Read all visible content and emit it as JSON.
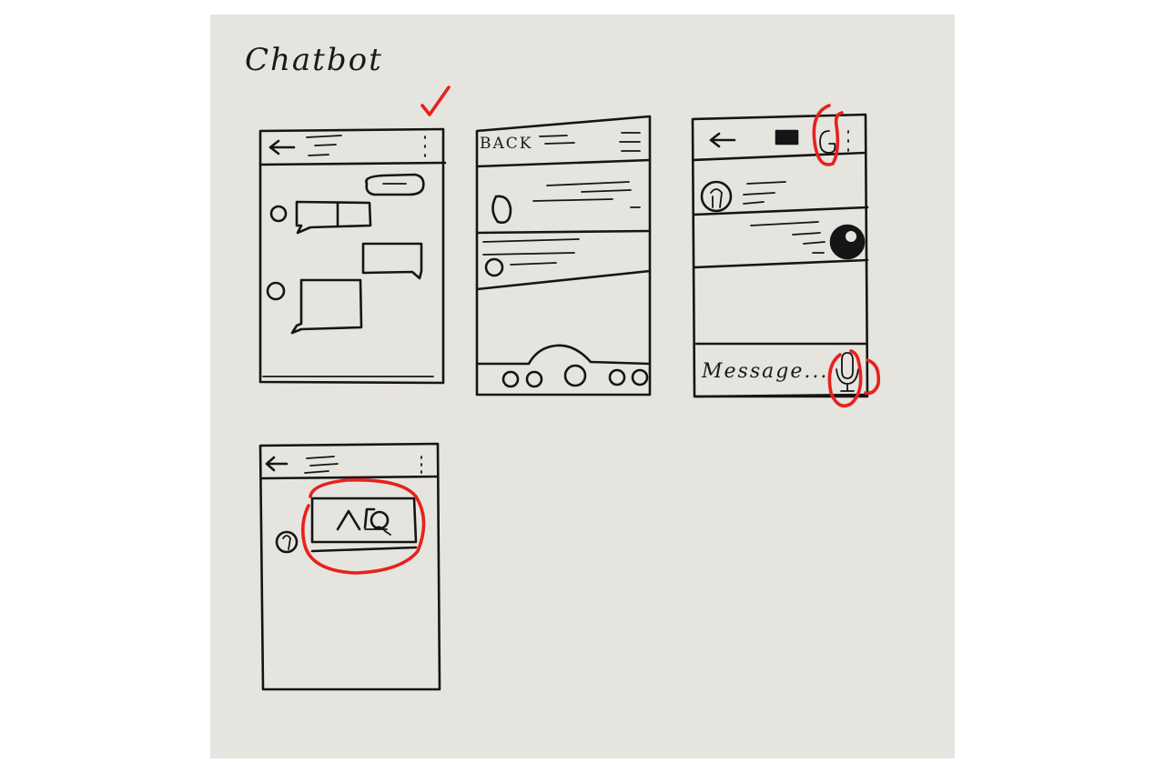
{
  "title": "Chatbot",
  "sketches": {
    "screen_2": {
      "back_label": "BACK"
    },
    "screen_3": {
      "message_placeholder": "Message..."
    }
  },
  "colors": {
    "paper": "#e6e4df",
    "ink": "#151515",
    "annotation": "#e8211d"
  }
}
